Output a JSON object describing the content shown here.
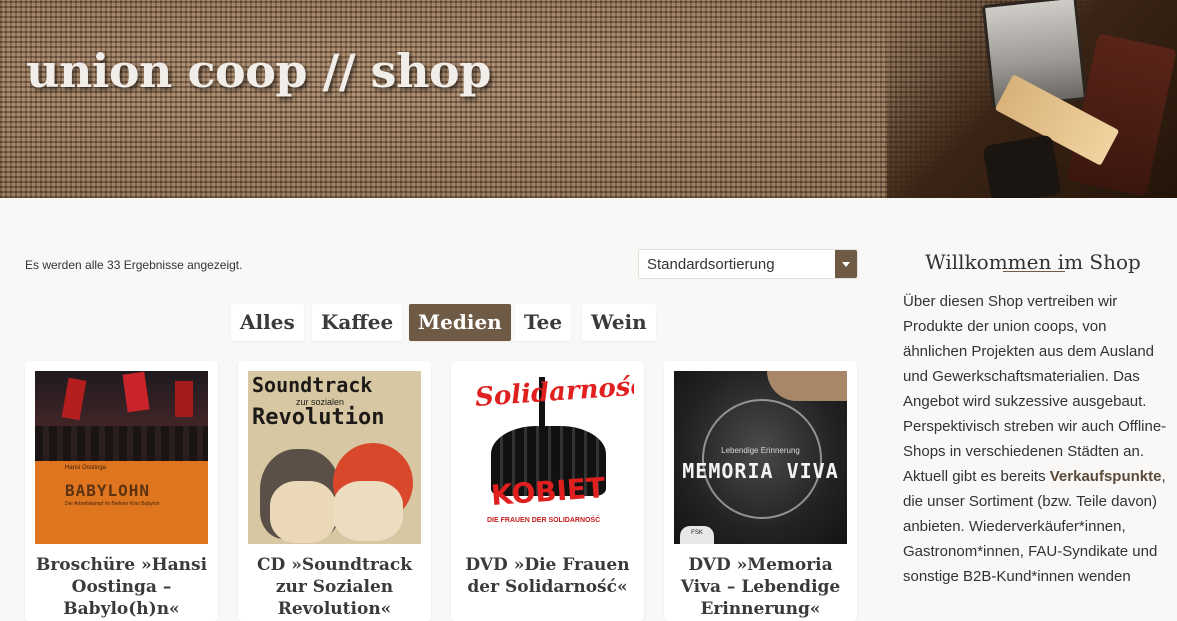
{
  "header": {
    "title": "union coop // shop"
  },
  "results": {
    "count_text": "Es werden alle 33 Ergebnisse angezeigt."
  },
  "sort": {
    "selected": "Standardsortierung"
  },
  "filters": [
    {
      "label": "Alles",
      "active": false
    },
    {
      "label": "Kaffee",
      "active": false
    },
    {
      "label": "Medien",
      "active": true
    },
    {
      "label": "Tee",
      "active": false
    },
    {
      "label": "Wein",
      "active": false
    }
  ],
  "products": [
    {
      "title": "Broschüre »Hansi Oostinga – Babylo(h)n«",
      "cover": {
        "author": "Hansi Oostinga",
        "title": "BABYLOHN",
        "subtitle": "Der Arbeitskampf im Berliner Kino Babylon"
      }
    },
    {
      "title": "CD »Soundtrack zur Sozialen Revolution«",
      "cover": {
        "line1": "Soundtrack",
        "line2": "zur sozialen",
        "line3": "Revolution"
      }
    },
    {
      "title": "DVD »Die Frauen der Solidarność«",
      "cover": {
        "top": "Solidarność",
        "main": "KOBIET",
        "sub": "DIE FRAUEN DER SOLIDARNOŚĆ"
      }
    },
    {
      "title": "DVD »Memoria Viva – Lebendige Erinnerung«",
      "cover": {
        "small": "Lebendige Erinnerung",
        "main": "MEMORIA VIVA",
        "badge": "FSK"
      }
    }
  ],
  "sidebar": {
    "title": "Willkommen im Shop",
    "text_before": "Über diesen Shop vertreiben wir Produkte der union coops, von ähnlichen Projekten aus dem Ausland und Gewerkschaftsmaterialien. Das Angebot wird sukzessive ausgebaut. Perspektivisch streben wir auch Offline-Shops in verschiedenen Städten an. Aktuell gibt es bereits ",
    "link": "Verkaufspunkte",
    "text_after": ", die unser Sortiment (bzw. Teile davon) anbieten. Wiederverkäufer*innen, Gastronom*innen, FAU-Syndikate und sonstige B2B-Kund*innen wenden"
  }
}
